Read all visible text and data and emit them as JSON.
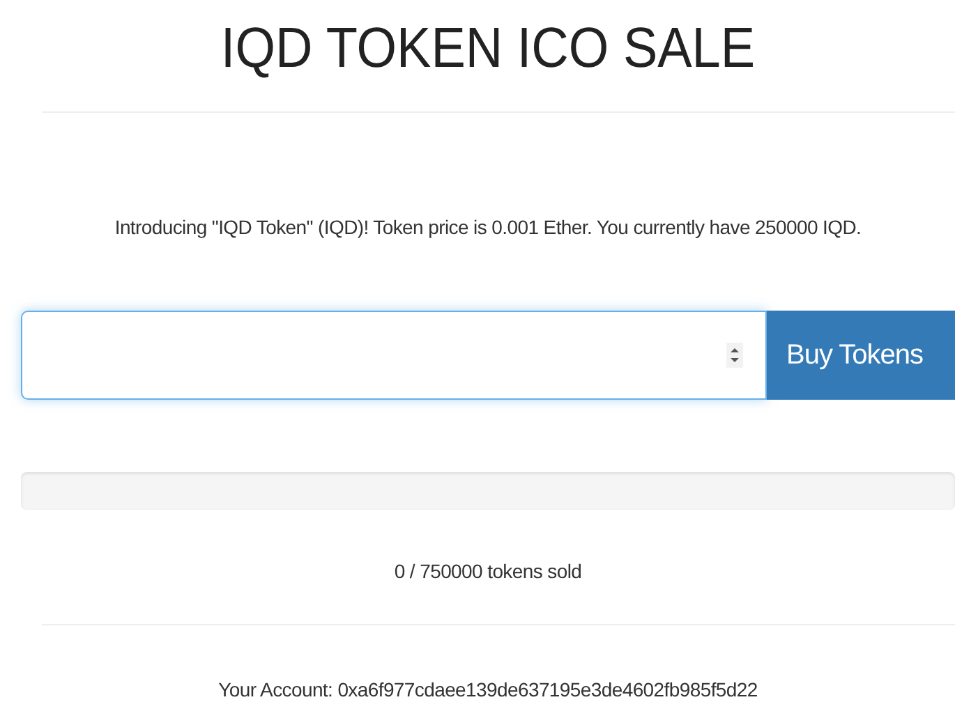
{
  "title": "IQD TOKEN ICO SALE",
  "intro": "Introducing \"IQD Token\" (IQD)! Token price is 0.001 Ether. You currently have 250000 IQD.",
  "purchase": {
    "button": "Buy Tokens"
  },
  "progress": {
    "level": 0
  },
  "sold": "0 / 750000 tokens sold",
  "account": "Your Account: 0xa6f977cdaee139de637195e3de4602fb985f5d22"
}
